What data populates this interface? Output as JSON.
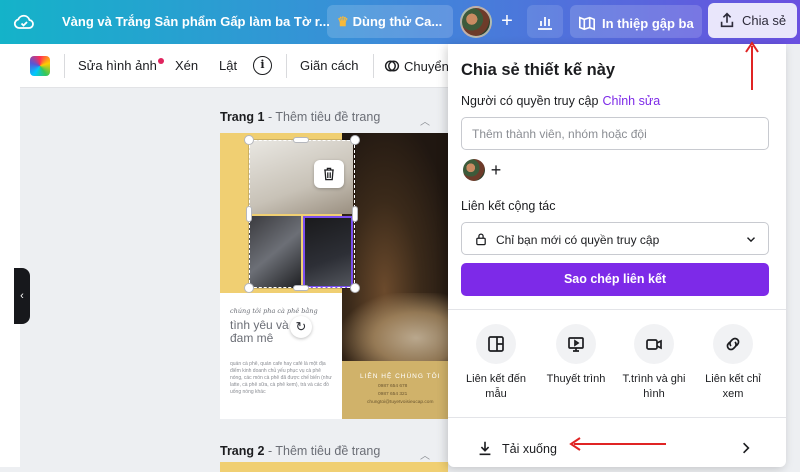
{
  "header": {
    "title": "Vàng và Trắng Sản phẩm Gấp làm ba Tờ r...",
    "trial_label": "Dùng thử Ca...",
    "card_label": "In thiệp gập ba",
    "share_label": "Chia sẻ"
  },
  "toolbar": {
    "edit_image": "Sửa hình ảnh",
    "crop": "Xén",
    "flip": "Lật",
    "info": "i",
    "spacing": "Giãn cách",
    "convert": "Chuyển"
  },
  "canvas": {
    "page1_label": "Trang 1",
    "page1_sub": " - Thêm tiêu đề trang",
    "page2_label": "Trang 2",
    "page2_sub": " - Thêm tiêu đề trang",
    "design": {
      "script_small": "chúng tôi pha cà phê bằng",
      "script_big": "tình yêu và đam mê",
      "body": "quán cà phê, quán cafe hay café là một địa điểm kinh doanh chủ yếu phục vụ cà phê nóng, các món cà phê đã được chế biến (như latte, cà phê sữa, cà phê kem), trà và các đồ uống nóng khác",
      "contact_title": "LIÊN HỆ CHÚNG TÔI",
      "contact_lines": [
        "0987 654 678",
        "0987 654 321",
        "chungtoi@tuyetvoisieucap.com"
      ]
    }
  },
  "share_panel": {
    "title": "Chia sẻ thiết kế này",
    "access_label": "Người có quyền truy cập",
    "access_link": "Chỉnh sửa",
    "input_placeholder": "Thêm thành viên, nhóm hoặc đội",
    "collab_label": "Liên kết cộng tác",
    "collab_value": "Chỉ bạn mới có quyền truy cập",
    "copy_label": "Sao chép liên kết",
    "options": [
      {
        "label": "Liên kết đến mẫu",
        "icon": "template-icon"
      },
      {
        "label": "Thuyết trình",
        "icon": "presentation-icon"
      },
      {
        "label": "T.trình và ghi hình",
        "icon": "video-camera-icon"
      },
      {
        "label": "Liên kết chỉ xem",
        "icon": "link-icon"
      }
    ],
    "download_label": "Tải xuống"
  },
  "colors": {
    "accent": "#7d2ae8",
    "annotation_arrow": "#e02424",
    "share_button_bg": "#e9e6fb"
  }
}
